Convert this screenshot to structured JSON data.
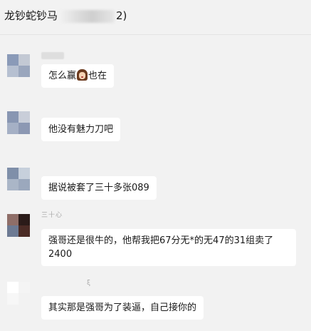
{
  "header": {
    "title_prefix": "龙钞蛇钞马",
    "title_suffix": "2)"
  },
  "messages": [
    {
      "text_before": "怎么赢",
      "emoji_icon": "girl-face-emoji",
      "text_after": "也在",
      "avatar_colors": [
        "#8a9ab8",
        "#c3c9d4",
        "#b6c0d1",
        "#9aa6bd"
      ]
    },
    {
      "text": "他没有魅力刀吧",
      "avatar_colors": [
        "#8896b2",
        "#c9ced9",
        "#a5b0c5",
        "#8c98b3"
      ]
    },
    {
      "text": "据说被套了三十多张089",
      "avatar_colors": [
        "#7f8fa9",
        "#c7d0dc",
        "#aab6c7",
        "#9ba8bd"
      ]
    },
    {
      "sender_name": "三十心",
      "text": "强哥还是很牛的，他帮我把67分无*的无47的31组卖了2400",
      "avatar_colors": [
        "#8f6e68",
        "#2b1b19",
        "#6d7a93",
        "#4b2b25"
      ]
    },
    {
      "sender_name": "ξ",
      "text": "其实那是强哥为了装逼，自己接你的",
      "avatar_colors": [
        "#ffffff",
        "#f4f4f4",
        "#f7f7f7",
        "#f2f2f2"
      ]
    }
  ]
}
